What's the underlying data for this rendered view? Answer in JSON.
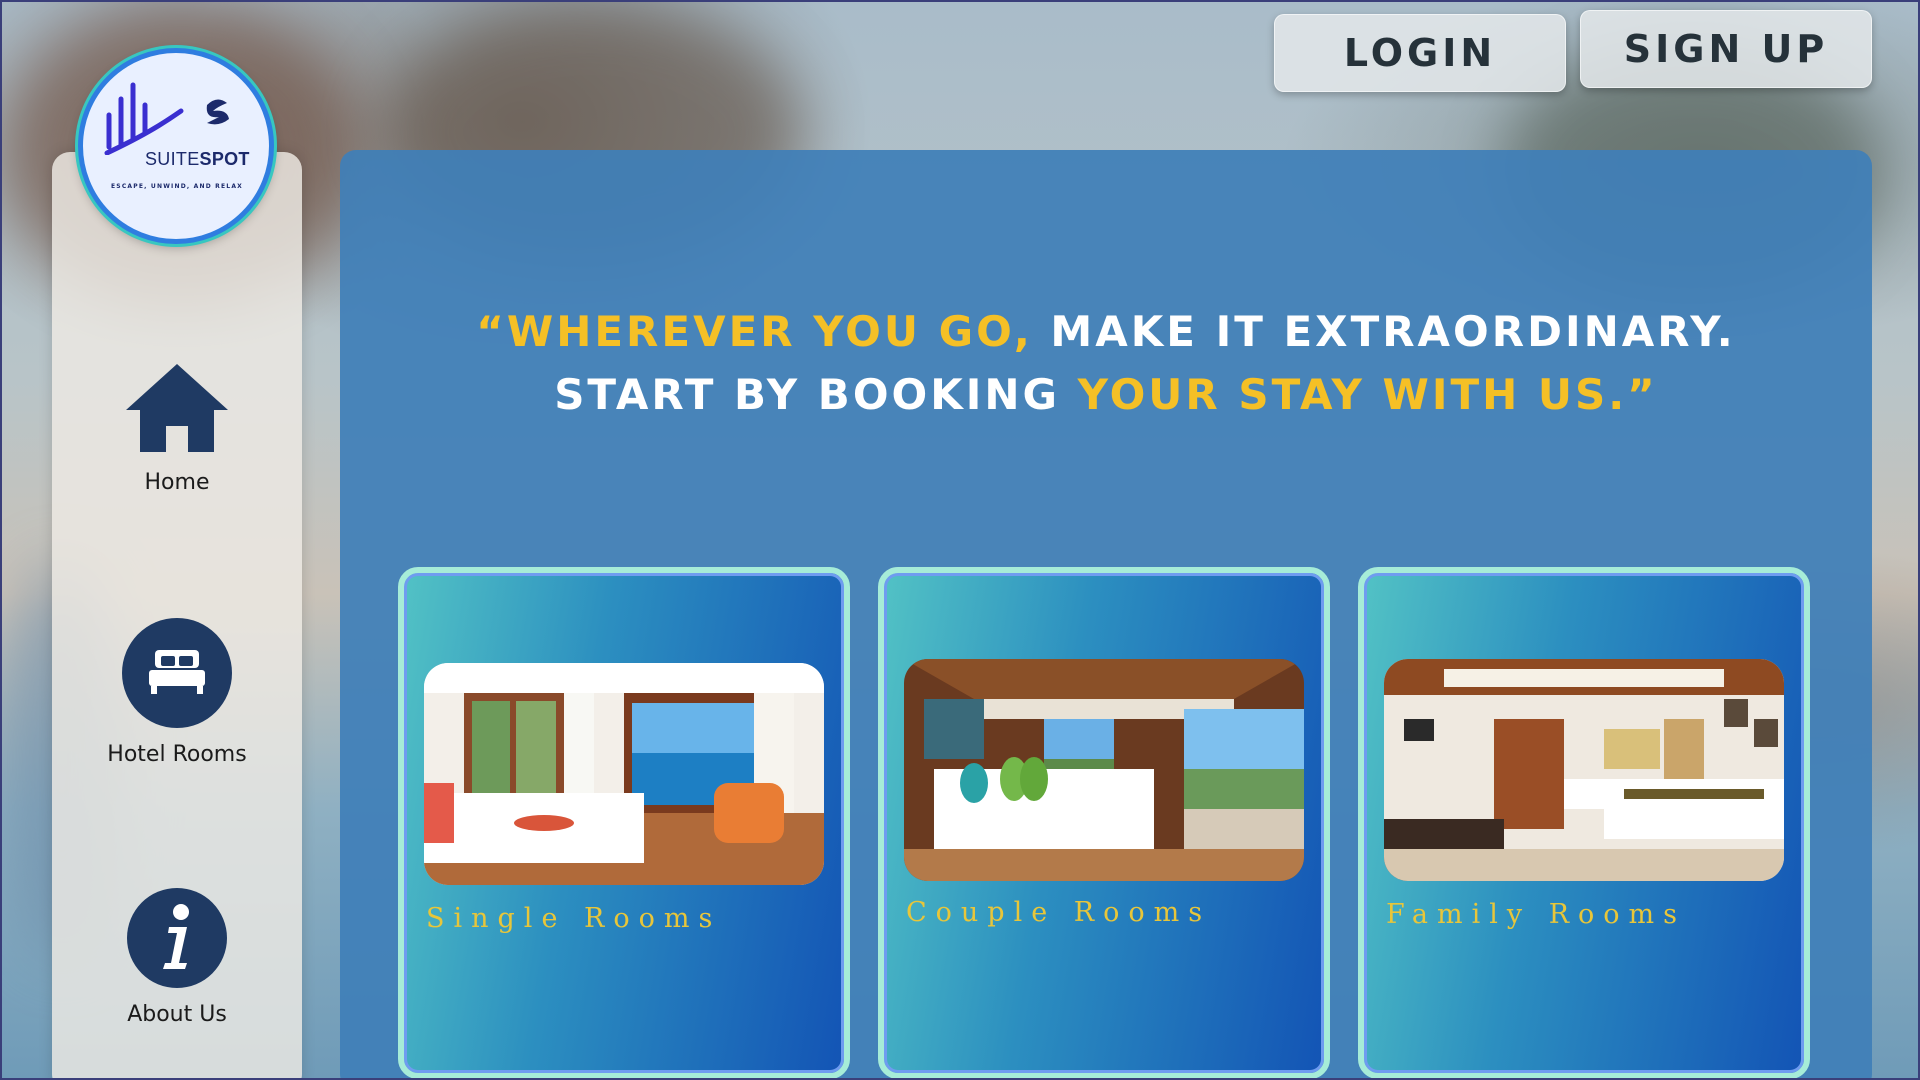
{
  "brand": {
    "name_part1": "SUITE",
    "name_part2": "SPOT",
    "tagline": "ESCAPE, UNWIND, AND RELAX"
  },
  "auth": {
    "login_label": "LOGIN",
    "signup_label": "SIGN UP"
  },
  "sidebar": {
    "items": [
      {
        "label": "Home",
        "icon": "home-icon"
      },
      {
        "label": "Hotel Rooms",
        "icon": "bed-icon"
      },
      {
        "label": "About Us",
        "icon": "info-icon"
      }
    ]
  },
  "hero": {
    "line1_highlight": "“WHEREVER YOU GO,",
    "line1_rest": " MAKE IT EXTRAORDINARY.",
    "line2_start": "START BY BOOKING ",
    "line2_highlight": "YOUR STAY WITH US.”"
  },
  "rooms": [
    {
      "title": "Single Rooms"
    },
    {
      "title": "Couple Rooms"
    },
    {
      "title": "Family Rooms"
    }
  ],
  "colors": {
    "accent_yellow": "#f5c026",
    "panel_blue": "#407fb8",
    "icon_navy": "#1f3a63"
  }
}
